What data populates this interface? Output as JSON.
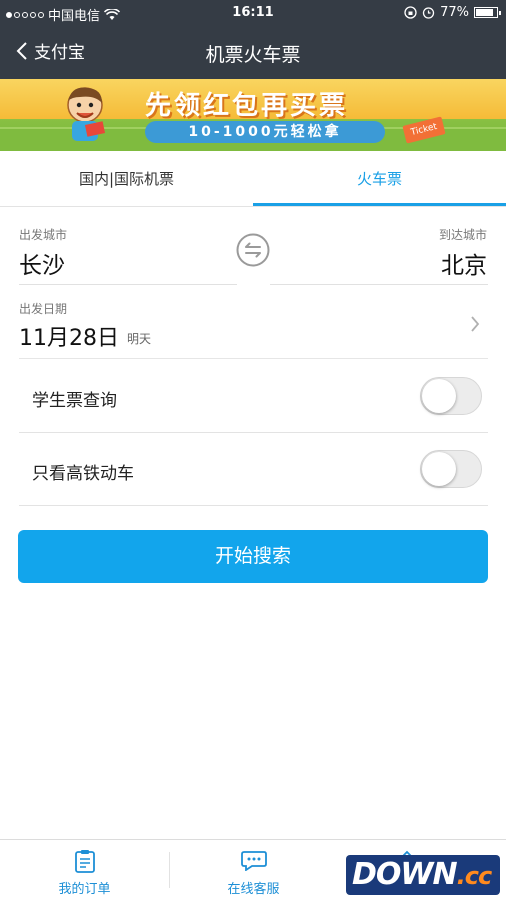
{
  "status_bar": {
    "carrier": "中国电信",
    "time": "16:11",
    "battery": "77%",
    "signal_bars_filled": 1
  },
  "nav": {
    "back_label": "支付宝",
    "title": "机票火车票"
  },
  "banner": {
    "headline": "先领红包再买票",
    "subline": "10-1000元轻松拿",
    "ticket_text": "Ticket"
  },
  "tabs": [
    {
      "label": "国内|国际机票"
    },
    {
      "label": "火车票",
      "active": true
    }
  ],
  "form": {
    "from_label": "出发城市",
    "from_city": "长沙",
    "to_label": "到达城市",
    "to_city": "北京",
    "date_label": "出发日期",
    "date_value": "11月28日",
    "date_note": "明天"
  },
  "toggles": [
    {
      "label": "学生票查询",
      "on": false
    },
    {
      "label": "只看高铁动车",
      "on": false
    }
  ],
  "search_button": "开始搜索",
  "bottom_bar": [
    {
      "label": "我的订单",
      "icon": "order-icon"
    },
    {
      "label": "在线客服",
      "icon": "chat-icon"
    },
    {
      "label": "",
      "icon": "edit-icon"
    }
  ],
  "watermark": {
    "main": "DOWN",
    "suffix": ".cc"
  },
  "colors": {
    "accent": "#12a5ec",
    "header": "#353c45",
    "tab_active": "#1aa0e6"
  }
}
